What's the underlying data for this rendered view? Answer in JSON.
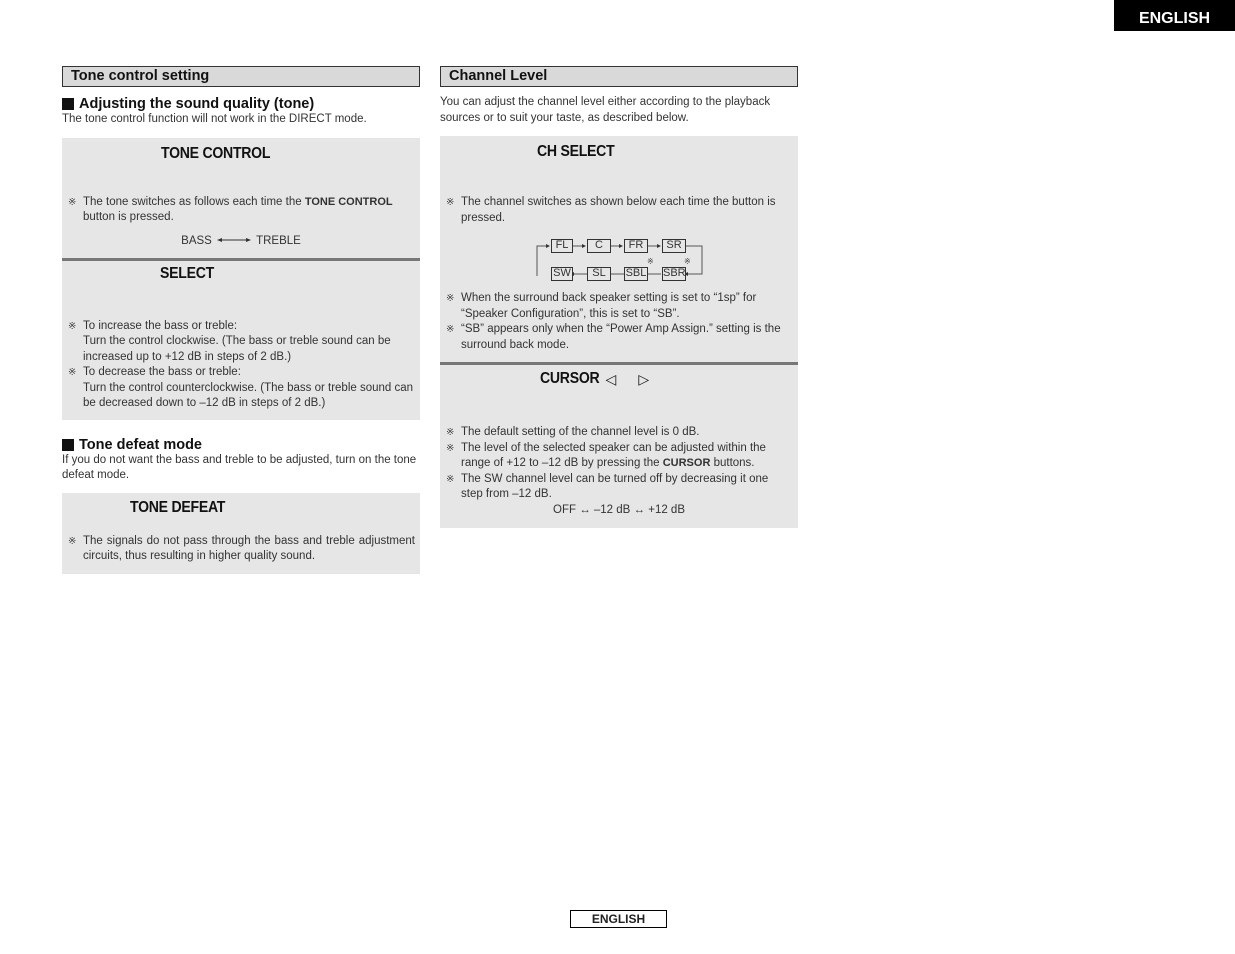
{
  "language_tab": "ENGLISH",
  "footer_language": "ENGLISH",
  "left": {
    "section_title": "Tone control setting",
    "sub1": {
      "heading": "Adjusting the sound quality (tone)",
      "intro": "The tone control function will not work in the DIRECT mode."
    },
    "tone_control_panel": {
      "button_name": "TONE CONTROL",
      "note_mark": "※",
      "note_pre": "The tone switches as follows each time the ",
      "note_bold": "TONE CONTROL",
      "note_post": " button is pressed.",
      "sequence_from": "BASS",
      "sequence_to": "TREBLE"
    },
    "select_panel": {
      "button_name": "SELECT",
      "notes": [
        {
          "mark": "※",
          "line1": "To increase the bass or treble:",
          "line2": "Turn the control clockwise. (The bass or treble sound can be increased up to +12 dB in steps of 2 dB.)"
        },
        {
          "mark": "※",
          "line1": "To decrease the bass or treble:",
          "line2": "Turn the control counterclockwise. (The bass or treble sound can be decreased down to –12 dB in steps of 2 dB.)"
        }
      ]
    },
    "sub2": {
      "heading": "Tone defeat mode",
      "intro": "If you do not want the bass and treble to be adjusted, turn on the tone defeat mode."
    },
    "tone_defeat_panel": {
      "button_name": "TONE DEFEAT",
      "note_mark": "※",
      "note": "The signals do not pass through the bass and treble adjustment circuits, thus resulting in higher quality sound."
    }
  },
  "right": {
    "section_title": "Channel Level",
    "intro": "You can adjust the channel level either according to the playback sources or to suit your taste, as described below.",
    "ch_select_panel": {
      "button_name": "CH SELECT",
      "note_mark": "※",
      "note": "The channel switches as shown below each time the button is pressed.",
      "channels_top": [
        "FL",
        "C",
        "FR",
        "SR"
      ],
      "channels_bottom": [
        "SW",
        "SL",
        "SBL",
        "SBR"
      ],
      "channel_footnote_mark": "※",
      "notes": [
        {
          "mark": "※",
          "text": "When the surround back speaker setting is set to “1sp” for “Speaker Configuration”, this is set to “SB”."
        },
        {
          "mark": "※",
          "text": "“SB” appears only when the “Power Amp Assign.” setting is the surround back mode."
        }
      ]
    },
    "cursor_panel": {
      "button_name": "CURSOR",
      "left_icon": "◁",
      "right_icon": "▷",
      "notes": [
        {
          "mark": "※",
          "text": "The default setting of the channel level is 0 dB."
        },
        {
          "mark": "※",
          "pre": "The level of the selected speaker can be adjusted within the range of +12 to –12 dB by pressing the ",
          "bold": "CURSOR",
          "post": " buttons."
        },
        {
          "mark": "※",
          "text": "The SW channel level can be turned off by decreasing it one step from –12 dB."
        }
      ],
      "range_line": "OFF ↔ –12 dB ↔ +12 dB"
    }
  }
}
